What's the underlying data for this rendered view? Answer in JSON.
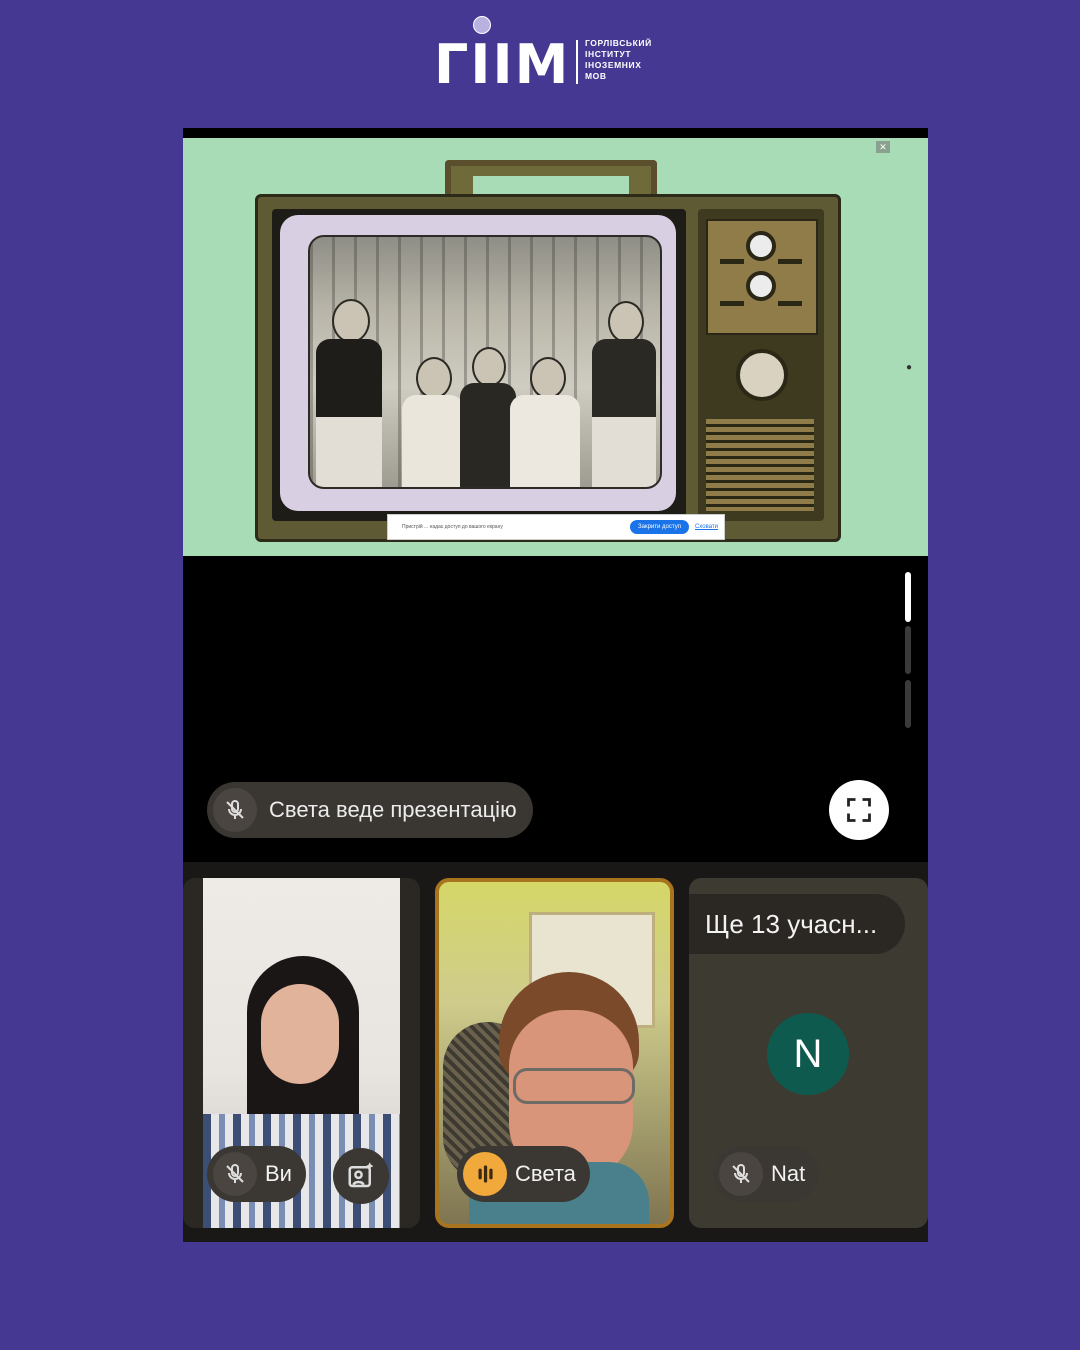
{
  "logo": {
    "wordmark": "ГІІМ",
    "lines": [
      "ГОРЛІВСЬКИЙ",
      "ІНСТИТУТ",
      "ІНОЗЕМНИХ",
      "МОВ"
    ]
  },
  "presentation": {
    "presenter_label": "Света веде презентацію",
    "share_banner": {
      "message": "Пристрій ... надає доступ до вашого екрану",
      "stop_label": "Закрити доступ",
      "hide_label": "Сховати"
    }
  },
  "participants": {
    "self_label": "Ви",
    "speaker_label": "Света",
    "more_label": "Ще 13 учасн...",
    "other_initial": "N",
    "other_label": "Nat"
  },
  "colors": {
    "page_bg": "#443892",
    "share_bg": "#a8dcb6",
    "speaker_border": "#a8741e",
    "avatar_bg": "#0f5a4e"
  },
  "icons": {
    "mic_off": "mic-off-icon",
    "fullscreen": "fullscreen-icon",
    "audio_levels": "audio-levels-icon",
    "effects": "camera-effects-icon"
  }
}
